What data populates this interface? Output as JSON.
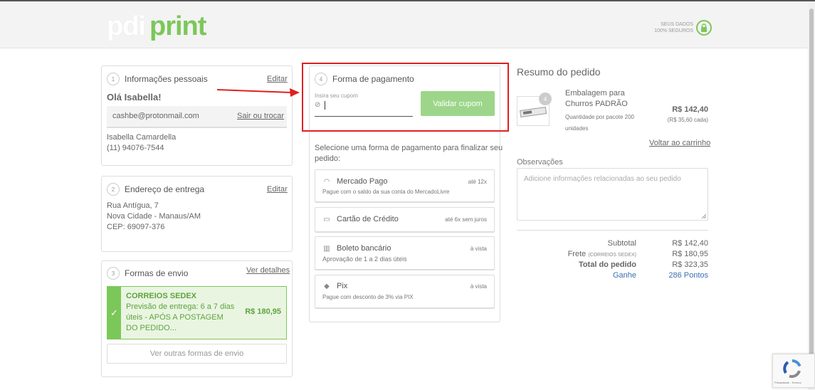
{
  "header": {
    "logo_pdi": "pdi",
    "logo_print": "print",
    "secure_line1": "SEUS DADOS",
    "secure_line2": "100% SEGUROS"
  },
  "personal": {
    "step": "1",
    "title": "Informações pessoais",
    "edit": "Editar",
    "greeting": "Olá Isabella!",
    "email": "cashbe@protonmail.com",
    "switch_link": "Sair ou trocar",
    "name": "Isabella Camardella",
    "phone": "(11) 94076-7544"
  },
  "address": {
    "step": "2",
    "title": "Endereço de entrega",
    "edit": "Editar",
    "line1": "Rua Antígua, 7",
    "line2": "Nova Cidade - Manaus/AM",
    "line3": "CEP: 69097-376"
  },
  "shipping": {
    "step": "3",
    "title": "Formas de envio",
    "details_link": "Ver detalhes",
    "option_name": "CORREIOS SEDEX",
    "option_desc1": "Previsão de entrega: 6 a 7 dias",
    "option_desc2": "úteis - APÓS A POSTAGEM",
    "option_desc3": "DO PEDIDO...",
    "option_price": "R$ 180,95",
    "other_button": "Ver outras formas de envio"
  },
  "payment": {
    "step": "4",
    "title": "Forma de pagamento",
    "coupon_label": "Insira seu cupom",
    "coupon_value": "",
    "coupon_button": "Validar cupom",
    "instructions": "Selecione uma forma de pagamento para finalizar seu",
    "instructions2": "pedido:",
    "methods": [
      {
        "name": "Mercado Pago",
        "right": "até 12x",
        "sub": "Pague com o saldo da sua conta do MercadoLivre"
      },
      {
        "name": "Cartão de Crédito",
        "right": "até 6x sem juros",
        "sub": ""
      },
      {
        "name": "Boleto bancário",
        "right": "à vista",
        "sub": "Aprovação de 1 a 2 dias úteis"
      },
      {
        "name": "Pix",
        "right": "à vista",
        "sub": "Pague com desconto de 3% via PIX"
      }
    ]
  },
  "summary": {
    "title": "Resumo do pedido",
    "item_qty": "4",
    "item_name1": "Embalagem para",
    "item_name2": "Churros PADRÃO",
    "item_note1": "Quantidade por pacote 200",
    "item_note2": "unidades",
    "item_price": "R$ 142,40",
    "item_unit": "(R$ 35,60 cada)",
    "back_link": "Voltar ao carrinho",
    "notes_label": "Observações",
    "notes_placeholder": "Adicione informações relacionadas ao seu pedido",
    "subtotal_label": "Subtotal",
    "subtotal_value": "R$ 142,40",
    "freight_label": "Frete",
    "freight_carrier": "(CORREIOS SEDEX)",
    "freight_value": "R$ 180,95",
    "total_label": "Total do pedido",
    "total_value": "R$ 323,35",
    "earn_label": "Ganhe",
    "earn_value": "286 Pontos"
  },
  "recaptcha": {
    "text": "Privacidade - Termos"
  }
}
